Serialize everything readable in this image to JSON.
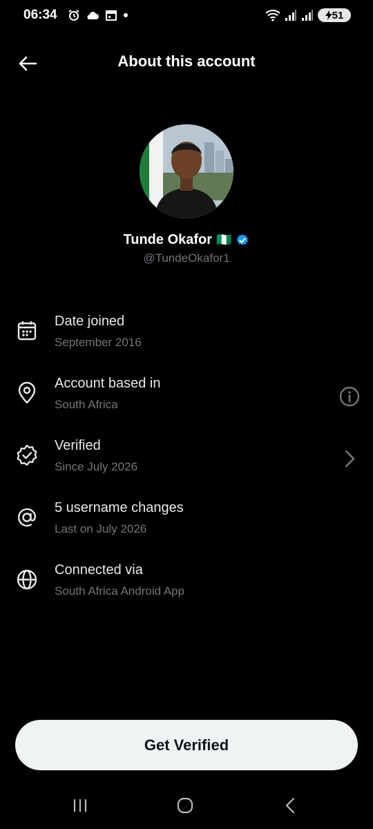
{
  "status_bar": {
    "time": "06:34",
    "battery": "51"
  },
  "header": {
    "title": "About this account"
  },
  "profile": {
    "name": "Tunde Okafor",
    "flag": "🇳🇬",
    "handle": "@TundeOkafor1"
  },
  "info": [
    {
      "title": "Date joined",
      "subtitle": "September 2016",
      "icon": "calendar-icon"
    },
    {
      "title": "Account based in",
      "subtitle": "South Africa",
      "icon": "location-pin-icon",
      "trailing": "info-icon"
    },
    {
      "title": "Verified",
      "subtitle": "Since July 2026",
      "icon": "verified-badge-icon",
      "trailing": "chevron-right-icon"
    },
    {
      "title": "5 username changes",
      "subtitle": "Last on July 2026",
      "icon": "at-sign-icon"
    },
    {
      "title": "Connected via",
      "subtitle": "South Africa Android App",
      "icon": "globe-icon"
    }
  ],
  "cta": {
    "label": "Get Verified"
  },
  "colors": {
    "background": "#000000",
    "text": "#e7e9ea",
    "muted": "#71767b",
    "verified": "#1d9bf0",
    "button_bg": "#eff3f4"
  }
}
